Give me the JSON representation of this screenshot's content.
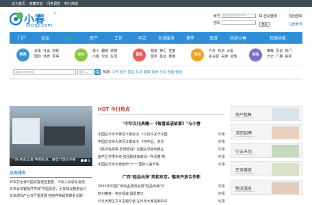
{
  "topbar": {
    "links": [
      "设为首页",
      "收藏本站",
      "问卷调查",
      "积分商城"
    ]
  },
  "logo": {
    "cn": "小春",
    "en": "incnjp.com",
    "reg": "®"
  },
  "login": {
    "account_label": "账号",
    "account_placeholder": "用户名/手机/Email",
    "password_label": "密码",
    "auto_login": "自动登录",
    "find_password": "找回密码",
    "login_button": "登录",
    "register": "注册账号"
  },
  "nav": {
    "items": [
      "门户",
      "论坛",
      "春卷",
      "房产",
      "工作",
      "中古",
      "生活服务",
      "留学",
      "旅游",
      "科研小春"
    ],
    "active_index": 2,
    "quick": "快速导航"
  },
  "categories": [
    {
      "circle": "新闻",
      "color": "#3b93d8",
      "links": [
        "日本",
        "社会",
        "财经",
        "国际",
        "体育",
        "军事"
      ]
    },
    {
      "circle": "论坛",
      "color": "#8cc63f",
      "links": [
        "单人",
        "趣味",
        "情感",
        "小组",
        "交友",
        "生活"
      ]
    },
    {
      "circle": "便民",
      "color": "#e85f5f",
      "links": [
        "物流",
        "换汇",
        "住宿",
        "留学",
        "签证",
        "旅游"
      ]
    },
    {
      "circle": "活动",
      "color": "#f5a023",
      "links": [
        "户外",
        "东京",
        "大阪",
        "名古屋",
        "关西",
        "其他"
      ]
    },
    {
      "circle": "动态",
      "color": "#7d6fcc",
      "links": [
        "推荐",
        "原创",
        "热门",
        "日记",
        "广播",
        "投票"
      ]
    }
  ],
  "search": {
    "placeholder": "请输入搜索内容",
    "select": "帖子",
    "hot_label": "热搜:",
    "hot_words": [
      "工作",
      "留学",
      "签证",
      "东京",
      "健康",
      "美食",
      "手机",
      "电脑",
      "物流"
    ]
  },
  "slider": {
    "caption": "广西·桂品出海\"亮相东京，魅显开放合作新",
    "dots": 3
  },
  "left_section": {
    "title": "点击排名",
    "items": [
      "日本护士考件国试客报告重要，不收入反驳写道洗",
      "日本会日客配件亭城\"中国风居，引发热议旅游会讨",
      "日本游戏产业日严重发展 物依存档是高联系长期"
    ]
  },
  "hot": {
    "title": "HOT 今日热点",
    "headline1": "\"中华文化典籍—《每看或语故事》\"与小春",
    "list1": [
      {
        "text": "中国驻日本大使见江德会决 《习近平关于中国",
        "tag": "时事"
      },
      {
        "text": "中国驻日本大使见江德会决 《持中品，关次",
        "tag": "时事"
      },
      {
        "text": "《民间有故事·发场想说》贫困先享受到很在",
        "tag": "时事"
      },
      {
        "text": "临平区打携手快·贫困职讲家商场一所青春\"新",
        "tag": "时事"
      },
      {
        "text": "中国驻日本大使受命\"六一\"国际儿童节快",
        "tag": "时事"
      }
    ],
    "headline2": "广西\"桂品出海\"亮相东京，魅显开放合作新",
    "list2": [
      {
        "text": "2025年中国广西商品博览会暨\"桂品出海\"日",
        "tag": "时事"
      },
      {
        "text": "杭州横排一将步视城·最愿意记",
        "tag": "时事"
      },
      {
        "text": "日本大数区文字主题交谈 在日本大家看到的中",
        "tag": "时事"
      }
    ]
  },
  "right_cards": [
    {
      "label": "房产租售",
      "pic": "#d8e4ec"
    },
    {
      "label": "求职招聘",
      "pic": "#e8d0c0"
    },
    {
      "label": "中古市场",
      "pic": "#c8d8c0"
    },
    {
      "label": "车务搬家",
      "pic": "#d8e0c8"
    },
    {
      "label": "物流服务",
      "pic": "#e0ccb8"
    }
  ]
}
